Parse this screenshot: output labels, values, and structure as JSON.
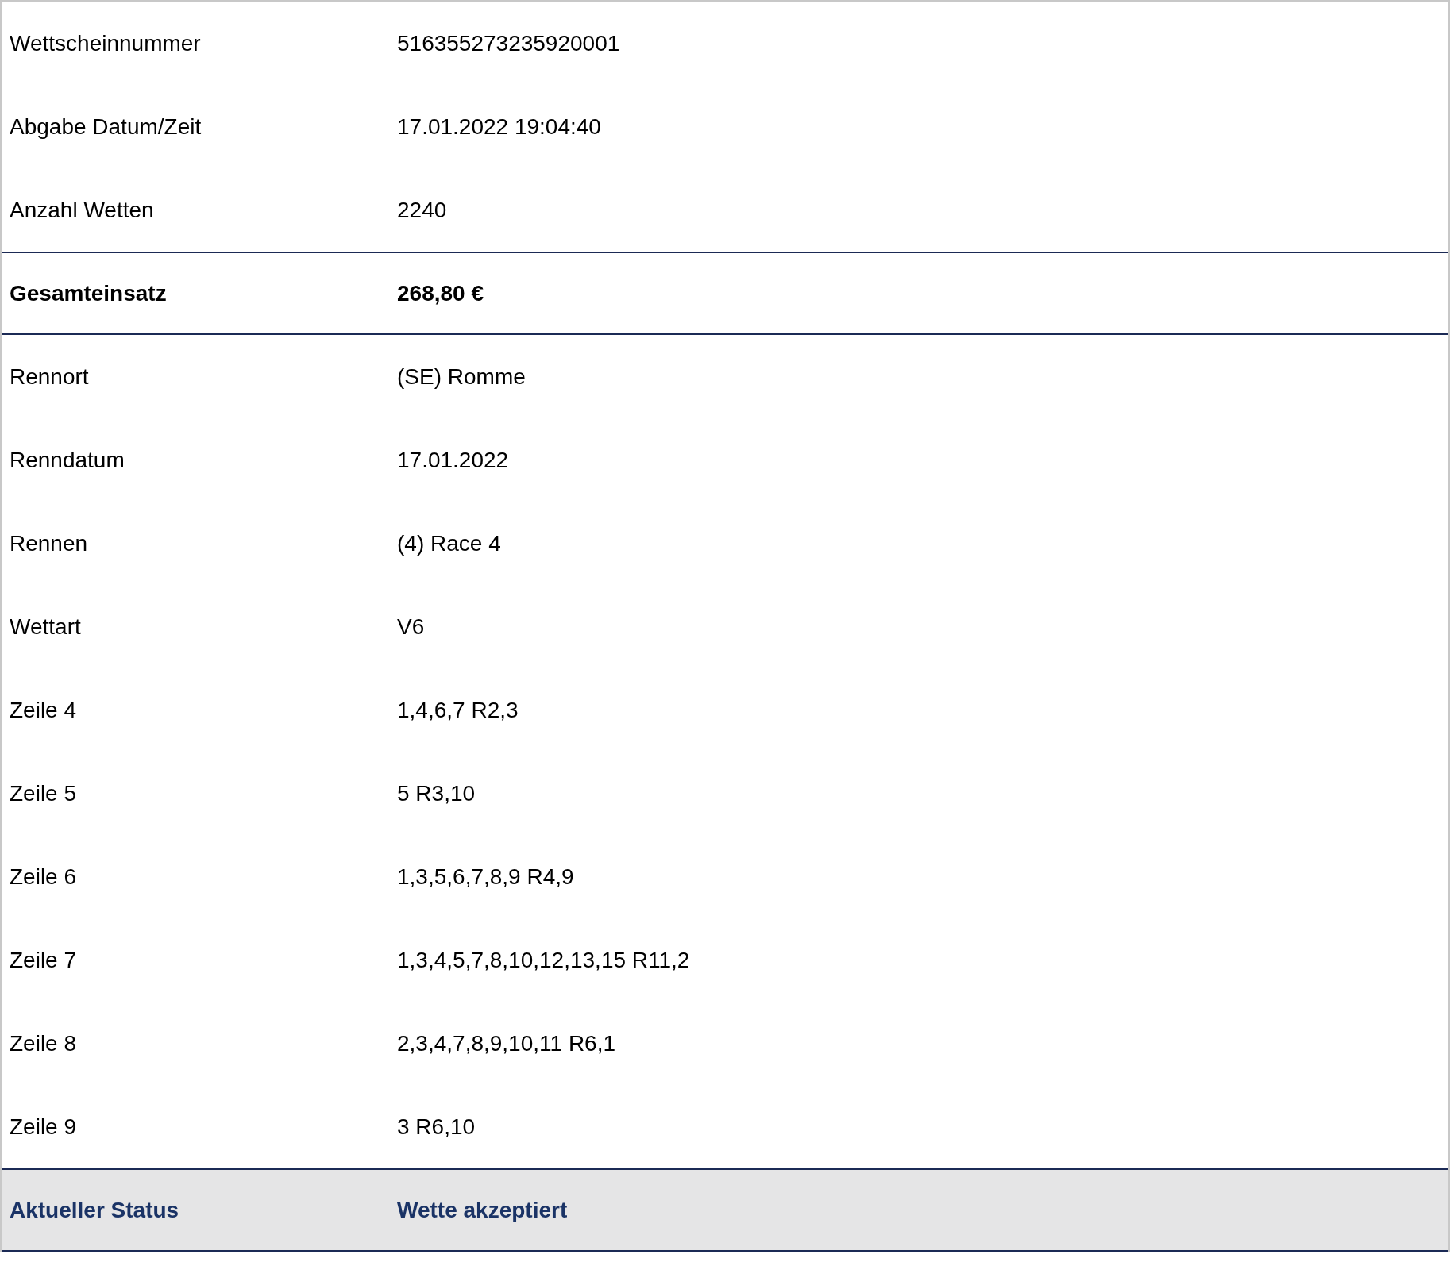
{
  "rows": [
    {
      "kind": "plain",
      "label": "Wettscheinnummer",
      "value": "516355273235920001"
    },
    {
      "kind": "plain",
      "label": "Abgabe Datum/Zeit",
      "value": "17.01.2022 19:04:40"
    },
    {
      "kind": "plain",
      "label": "Anzahl Wetten",
      "value": "2240"
    },
    {
      "kind": "total",
      "label": "Gesamteinsatz",
      "value": "268,80 €"
    },
    {
      "kind": "plain",
      "label": "Rennort",
      "value": "(SE) Romme"
    },
    {
      "kind": "plain",
      "label": "Renndatum",
      "value": "17.01.2022"
    },
    {
      "kind": "plain",
      "label": "Rennen",
      "value": "(4) Race 4"
    },
    {
      "kind": "plain",
      "label": "Wettart",
      "value": "V6"
    },
    {
      "kind": "plain",
      "label": "Zeile 4",
      "value": "1,4,6,7 R2,3"
    },
    {
      "kind": "plain",
      "label": "Zeile 5",
      "value": "5 R3,10"
    },
    {
      "kind": "plain",
      "label": "Zeile 6",
      "value": "1,3,5,6,7,8,9 R4,9"
    },
    {
      "kind": "plain",
      "label": "Zeile 7",
      "value": "1,3,4,5,7,8,10,12,13,15 R11,2"
    },
    {
      "kind": "plain",
      "label": "Zeile 8",
      "value": "2,3,4,7,8,9,10,11 R6,1"
    },
    {
      "kind": "plain",
      "label": "Zeile 9",
      "value": "3 R6,10"
    },
    {
      "kind": "status",
      "label": "Aktueller Status",
      "value": "Wette akzeptiert"
    }
  ]
}
